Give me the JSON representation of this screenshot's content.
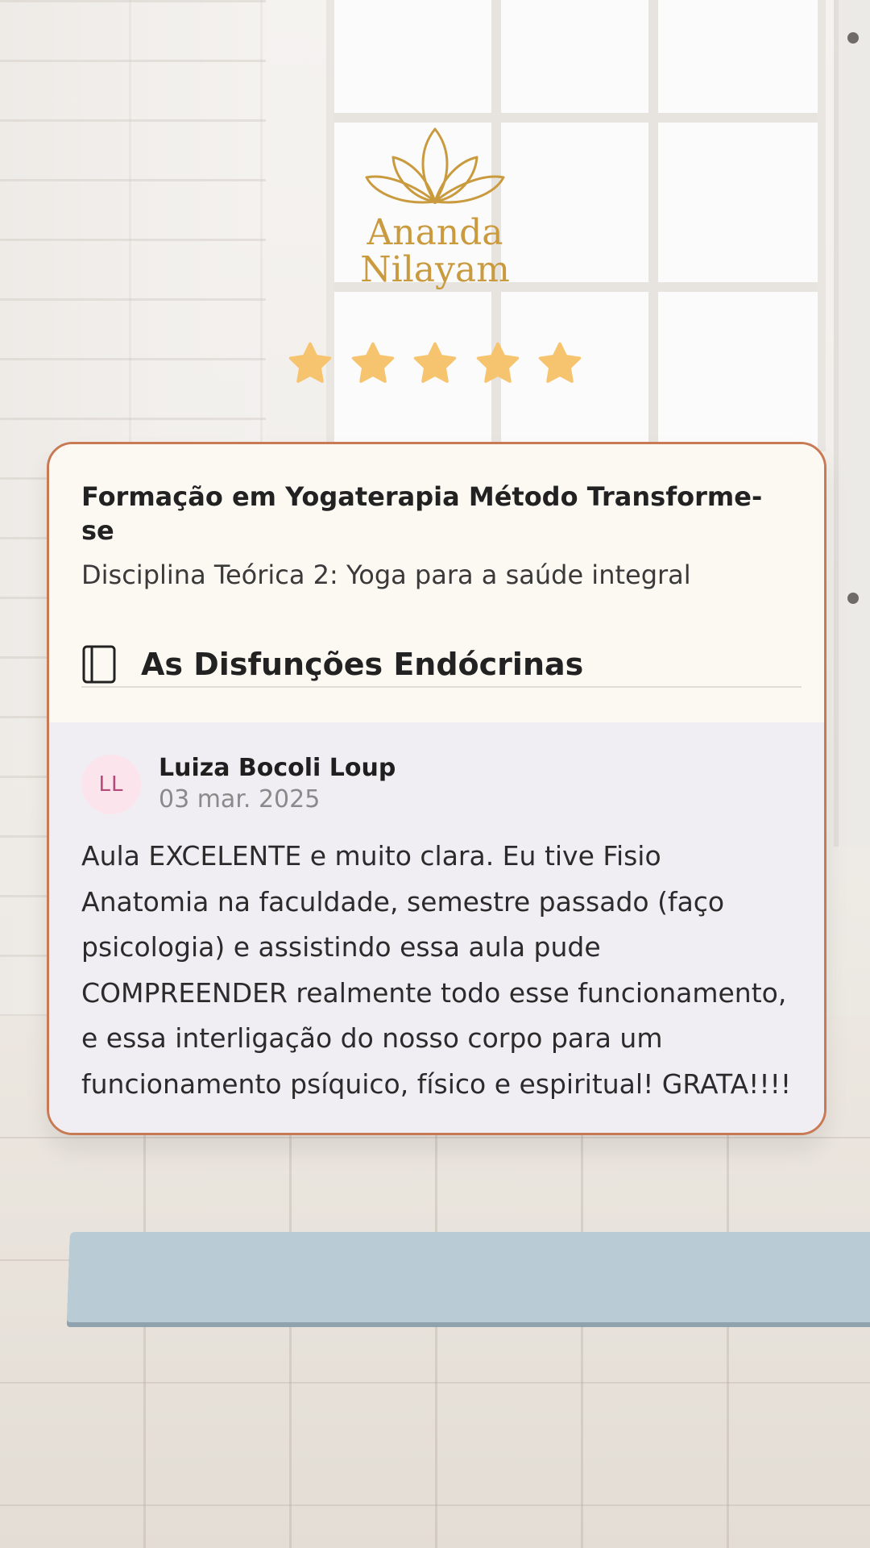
{
  "brand": {
    "name_line1": "Ananda",
    "name_line2": "Nilayam",
    "color": "#c99a3e"
  },
  "rating": {
    "stars": 5,
    "max": 5,
    "star_color": "#f6c46e"
  },
  "card": {
    "border_color": "#c87a55",
    "course_title": "Formação em Yogaterapia Método Transforme-se",
    "course_subtitle": "Disciplina Teórica 2: Yoga para a saúde integral",
    "lesson_icon": "book-icon",
    "lesson_title": "As Disfunções Endócrinas"
  },
  "review": {
    "avatar_initials": "LL",
    "avatar_bg": "#fbe4ec",
    "author": "Luiza Bocoli Loup",
    "date": "03 mar. 2025",
    "text": "Aula EXCELENTE e muito clara. Eu tive Fisio Anatomia na faculdade, semestre passado (faço psicologia) e assistindo essa aula pude COMPREENDER realmente todo esse funcionamento, e essa interligação do nosso corpo para um funcionamento psíquico, físico e espiritual! GRATA!!!!"
  }
}
